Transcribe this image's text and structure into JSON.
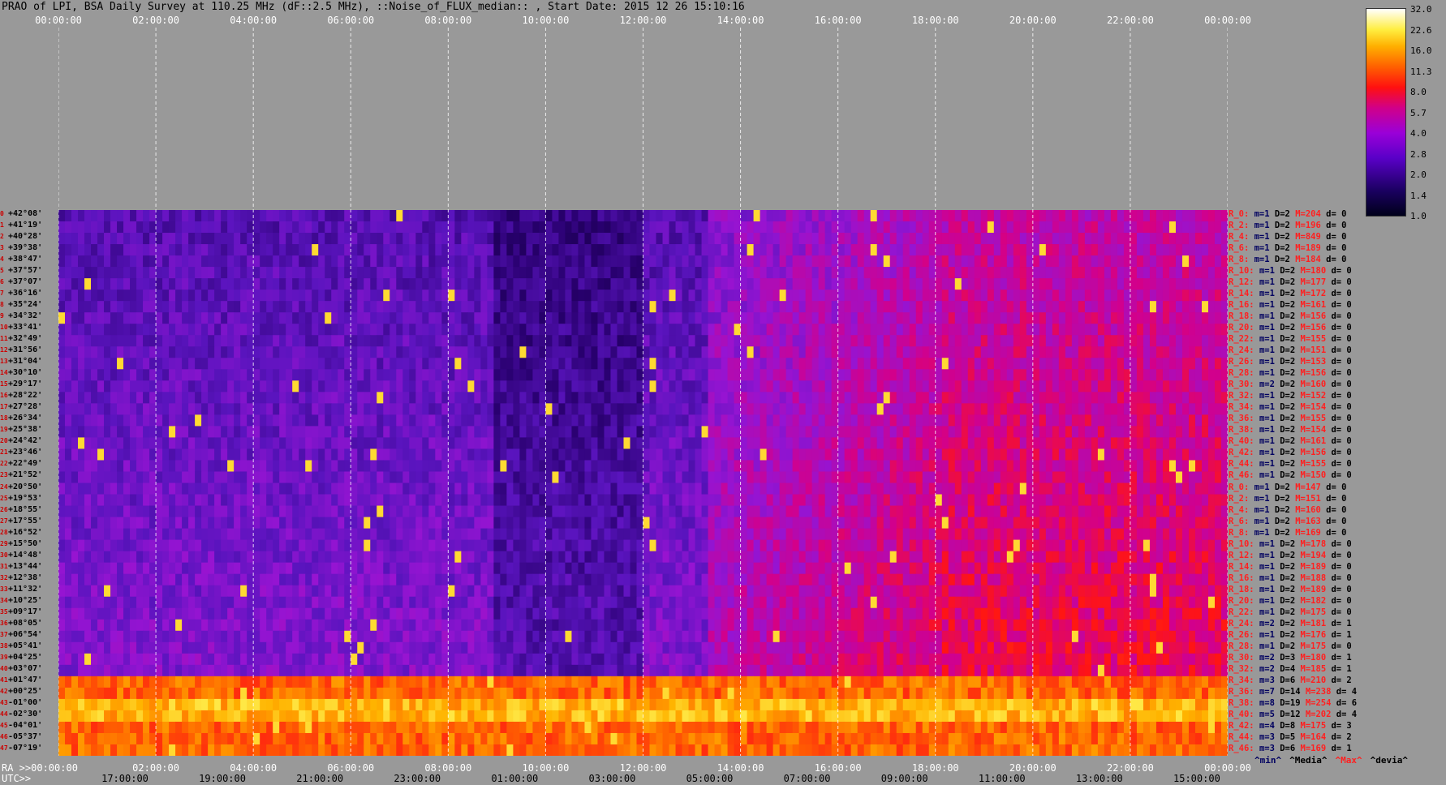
{
  "chart_data": {
    "type": "heatmap",
    "title": "PRAO of LPI, BSA Daily Survey at 110.25 MHz (dF::2.5 MHz), ::Noise_of_FLUX_median:: , Start Date: 2015 12 26 15:10:16",
    "top_ticks": [
      "00:00:00",
      "02:00:00",
      "04:00:00",
      "06:00:00",
      "08:00:00",
      "10:00:00",
      "12:00:00",
      "14:00:00",
      "16:00:00",
      "18:00:00",
      "20:00:00",
      "22:00:00",
      "00:00:00"
    ],
    "ra_label": "RA >>00:00:00",
    "ra_ticks": [
      "02:00:00",
      "04:00:00",
      "06:00:00",
      "08:00:00",
      "10:00:00",
      "12:00:00",
      "14:00:00",
      "16:00:00",
      "18:00:00",
      "20:00:00",
      "22:00:00",
      "00:00:00"
    ],
    "utc_label": "UTC>>",
    "utc_ticks": [
      "17:00:00",
      "19:00:00",
      "21:00:00",
      "23:00:00",
      "01:00:00",
      "03:00:00",
      "05:00:00",
      "07:00:00",
      "09:00:00",
      "11:00:00",
      "13:00:00",
      "15:00:00"
    ],
    "colorbar": [
      "32.0",
      "22.6",
      "16.0",
      "11.3",
      "8.0",
      "5.7",
      "4.0",
      "2.8",
      "2.0",
      "1.4",
      "1.0"
    ],
    "declinations": [
      "+42°08'",
      "+41°19'",
      "+40°28'",
      "+39°38'",
      "+38°47'",
      "+37°57'",
      "+37°07'",
      "+36°16'",
      "+35°24'",
      "+34°32'",
      "+33°41'",
      "+32°49'",
      "+31°56'",
      "+31°04'",
      "+30°10'",
      "+29°17'",
      "+28°22'",
      "+27°28'",
      "+26°34'",
      "+25°38'",
      "+24°42'",
      "+23°46'",
      "+22°49'",
      "+21°52'",
      "+20°50'",
      "+19°53'",
      "+18°55'",
      "+17°55'",
      "+16°52'",
      "+15°50'",
      "+14°48'",
      "+13°44'",
      "+12°38'",
      "+11°32'",
      "+10°25'",
      "+09°17'",
      "+08°05'",
      "+06°54'",
      "+05°41'",
      "+04°25'",
      "+03°07'",
      "+01°47'",
      "+00°25'",
      "-01°00'",
      "-02°30'",
      "-04°01'",
      "-05°37'",
      "-07°19'"
    ],
    "row_stats": [
      {
        "r": "R_0:",
        "m": "m=1",
        "D": "D=2",
        "M": "M=204",
        "d": "d= 0"
      },
      {
        "r": "R_2:",
        "m": "m=1",
        "D": "D=2",
        "M": "M=196",
        "d": "d= 0"
      },
      {
        "r": "R_4:",
        "m": "m=1",
        "D": "D=2",
        "M": "M=849",
        "d": "d= 0"
      },
      {
        "r": "R_6:",
        "m": "m=1",
        "D": "D=2",
        "M": "M=189",
        "d": "d= 0"
      },
      {
        "r": "R_8:",
        "m": "m=1",
        "D": "D=2",
        "M": "M=184",
        "d": "d= 0"
      },
      {
        "r": "R_10:",
        "m": "m=1",
        "D": "D=2",
        "M": "M=180",
        "d": "d= 0"
      },
      {
        "r": "R_12:",
        "m": "m=1",
        "D": "D=2",
        "M": "M=177",
        "d": "d= 0"
      },
      {
        "r": "R_14:",
        "m": "m=1",
        "D": "D=2",
        "M": "M=172",
        "d": "d= 0"
      },
      {
        "r": "R_16:",
        "m": "m=1",
        "D": "D=2",
        "M": "M=161",
        "d": "d= 0"
      },
      {
        "r": "R_18:",
        "m": "m=1",
        "D": "D=2",
        "M": "M=156",
        "d": "d= 0"
      },
      {
        "r": "R_20:",
        "m": "m=1",
        "D": "D=2",
        "M": "M=156",
        "d": "d= 0"
      },
      {
        "r": "R_22:",
        "m": "m=1",
        "D": "D=2",
        "M": "M=155",
        "d": "d= 0"
      },
      {
        "r": "R_24:",
        "m": "m=1",
        "D": "D=2",
        "M": "M=151",
        "d": "d= 0"
      },
      {
        "r": "R_26:",
        "m": "m=1",
        "D": "D=2",
        "M": "M=153",
        "d": "d= 0"
      },
      {
        "r": "R_28:",
        "m": "m=1",
        "D": "D=2",
        "M": "M=156",
        "d": "d= 0"
      },
      {
        "r": "R_30:",
        "m": "m=2",
        "D": "D=2",
        "M": "M=160",
        "d": "d= 0"
      },
      {
        "r": "R_32:",
        "m": "m=1",
        "D": "D=2",
        "M": "M=152",
        "d": "d= 0"
      },
      {
        "r": "R_34:",
        "m": "m=1",
        "D": "D=2",
        "M": "M=154",
        "d": "d= 0"
      },
      {
        "r": "R_36:",
        "m": "m=1",
        "D": "D=2",
        "M": "M=155",
        "d": "d= 0"
      },
      {
        "r": "R_38:",
        "m": "m=1",
        "D": "D=2",
        "M": "M=154",
        "d": "d= 0"
      },
      {
        "r": "R_40:",
        "m": "m=1",
        "D": "D=2",
        "M": "M=161",
        "d": "d= 0"
      },
      {
        "r": "R_42:",
        "m": "m=1",
        "D": "D=2",
        "M": "M=156",
        "d": "d= 0"
      },
      {
        "r": "R_44:",
        "m": "m=1",
        "D": "D=2",
        "M": "M=155",
        "d": "d= 0"
      },
      {
        "r": "R_46:",
        "m": "m=1",
        "D": "D=2",
        "M": "M=150",
        "d": "d= 0"
      },
      {
        "r": "R_0:",
        "m": "m=1",
        "D": "D=2",
        "M": "M=147",
        "d": "d= 0"
      },
      {
        "r": "R_2:",
        "m": "m=1",
        "D": "D=2",
        "M": "M=151",
        "d": "d= 0"
      },
      {
        "r": "R_4:",
        "m": "m=1",
        "D": "D=2",
        "M": "M=160",
        "d": "d= 0"
      },
      {
        "r": "R_6:",
        "m": "m=1",
        "D": "D=2",
        "M": "M=163",
        "d": "d= 0"
      },
      {
        "r": "R_8:",
        "m": "m=1",
        "D": "D=2",
        "M": "M=169",
        "d": "d= 0"
      },
      {
        "r": "R_10:",
        "m": "m=1",
        "D": "D=2",
        "M": "M=178",
        "d": "d= 0"
      },
      {
        "r": "R_12:",
        "m": "m=1",
        "D": "D=2",
        "M": "M=194",
        "d": "d= 0"
      },
      {
        "r": "R_14:",
        "m": "m=1",
        "D": "D=2",
        "M": "M=189",
        "d": "d= 0"
      },
      {
        "r": "R_16:",
        "m": "m=1",
        "D": "D=2",
        "M": "M=188",
        "d": "d= 0"
      },
      {
        "r": "R_18:",
        "m": "m=1",
        "D": "D=2",
        "M": "M=189",
        "d": "d= 0"
      },
      {
        "r": "R_20:",
        "m": "m=1",
        "D": "D=2",
        "M": "M=182",
        "d": "d= 0"
      },
      {
        "r": "R_22:",
        "m": "m=1",
        "D": "D=2",
        "M": "M=175",
        "d": "d= 0"
      },
      {
        "r": "R_24:",
        "m": "m=2",
        "D": "D=2",
        "M": "M=181",
        "d": "d= 1"
      },
      {
        "r": "R_26:",
        "m": "m=1",
        "D": "D=2",
        "M": "M=176",
        "d": "d= 1"
      },
      {
        "r": "R_28:",
        "m": "m=1",
        "D": "D=2",
        "M": "M=175",
        "d": "d= 0"
      },
      {
        "r": "R_30:",
        "m": "m=2",
        "D": "D=3",
        "M": "M=180",
        "d": "d= 1"
      },
      {
        "r": "R_32:",
        "m": "m=2",
        "D": "D=4",
        "M": "M=185",
        "d": "d= 1"
      },
      {
        "r": "R_34:",
        "m": "m=3",
        "D": "D=6",
        "M": "M=210",
        "d": "d= 2"
      },
      {
        "r": "R_36:",
        "m": "m=7",
        "D": "D=14",
        "M": "M=238",
        "d": "d= 4"
      },
      {
        "r": "R_38:",
        "m": "m=8",
        "D": "D=19",
        "M": "M=254",
        "d": "d= 6"
      },
      {
        "r": "R_40:",
        "m": "m=5",
        "D": "D=12",
        "M": "M=202",
        "d": "d= 4"
      },
      {
        "r": "R_42:",
        "m": "m=4",
        "D": "D=8",
        "M": "M=175",
        "d": "d= 3"
      },
      {
        "r": "R_44:",
        "m": "m=3",
        "D": "D=5",
        "M": "M=164",
        "d": "d= 2"
      },
      {
        "r": "R_46:",
        "m": "m=3",
        "D": "D=6",
        "M": "M=169",
        "d": "d= 1"
      }
    ],
    "legend": [
      "^min^",
      "^Media^",
      "^Max^",
      "^devia^"
    ]
  }
}
